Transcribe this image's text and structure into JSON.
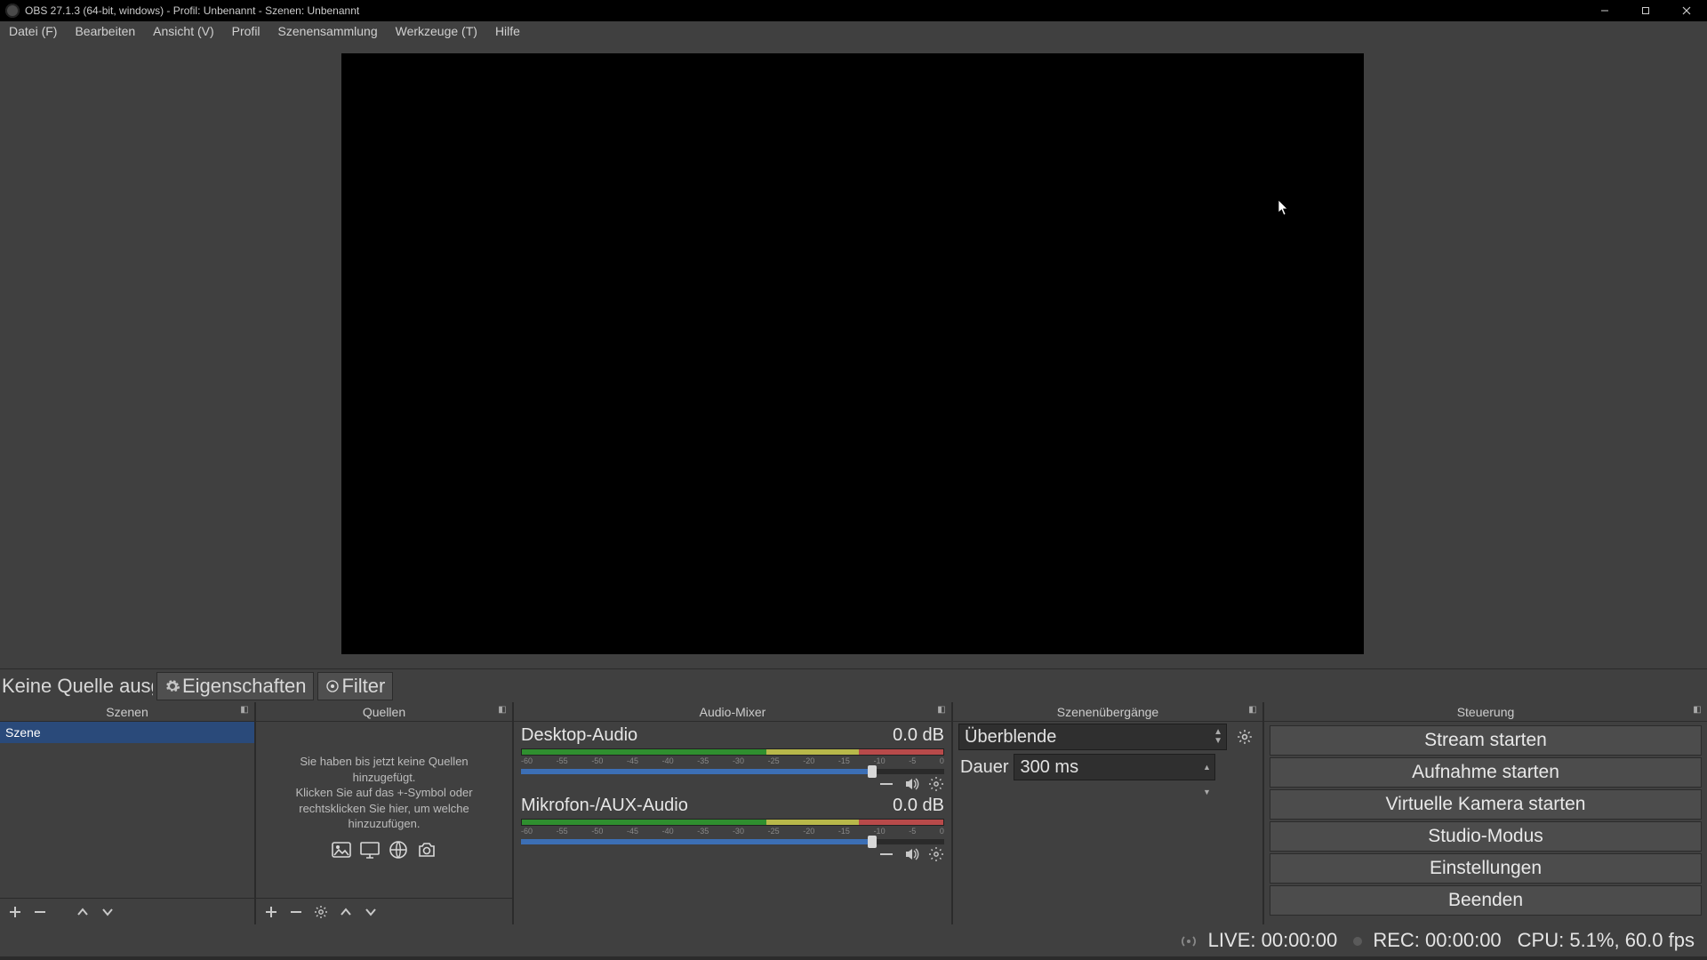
{
  "window": {
    "title": "OBS 27.1.3 (64-bit, windows) - Profil: Unbenannt - Szenen: Unbenannt"
  },
  "menu": {
    "file": "Datei (F)",
    "edit": "Bearbeiten",
    "view": "Ansicht (V)",
    "profile": "Profil",
    "scene_collection": "Szenensammlung",
    "tools": "Werkzeuge (T)",
    "help": "Hilfe"
  },
  "context_bar": {
    "no_source": "Keine Quelle ausgewählt",
    "properties": "Eigenschaften",
    "filter": "Filter"
  },
  "docks": {
    "scenes": {
      "title": "Szenen",
      "items": [
        "Szene"
      ]
    },
    "sources": {
      "title": "Quellen",
      "placeholder_l1": "Sie haben bis jetzt keine Quellen hinzugefügt.",
      "placeholder_l2": "Klicken Sie auf das +-Symbol oder rechtsklicken Sie hier, um welche hinzuzufügen."
    },
    "mixer": {
      "title": "Audio-Mixer",
      "tracks": [
        {
          "name": "Desktop-Audio",
          "level": "0.0 dB"
        },
        {
          "name": "Mikrofon-/AUX-Audio",
          "level": "0.0 dB"
        }
      ],
      "ticks": [
        "-60",
        "-55",
        "-50",
        "-45",
        "-40",
        "-35",
        "-30",
        "-25",
        "-20",
        "-15",
        "-10",
        "-5",
        "0"
      ]
    },
    "transitions": {
      "title": "Szenenübergänge",
      "selected": "Überblende",
      "duration_label": "Dauer",
      "duration_value": "300 ms"
    },
    "controls": {
      "title": "Steuerung",
      "buttons": {
        "stream": "Stream starten",
        "record": "Aufnahme starten",
        "vcam": "Virtuelle Kamera starten",
        "studio": "Studio-Modus",
        "settings": "Einstellungen",
        "exit": "Beenden"
      }
    }
  },
  "status": {
    "live": "LIVE: 00:00:00",
    "rec": "REC: 00:00:00",
    "cpu": "CPU: 5.1%, 60.0 fps"
  }
}
